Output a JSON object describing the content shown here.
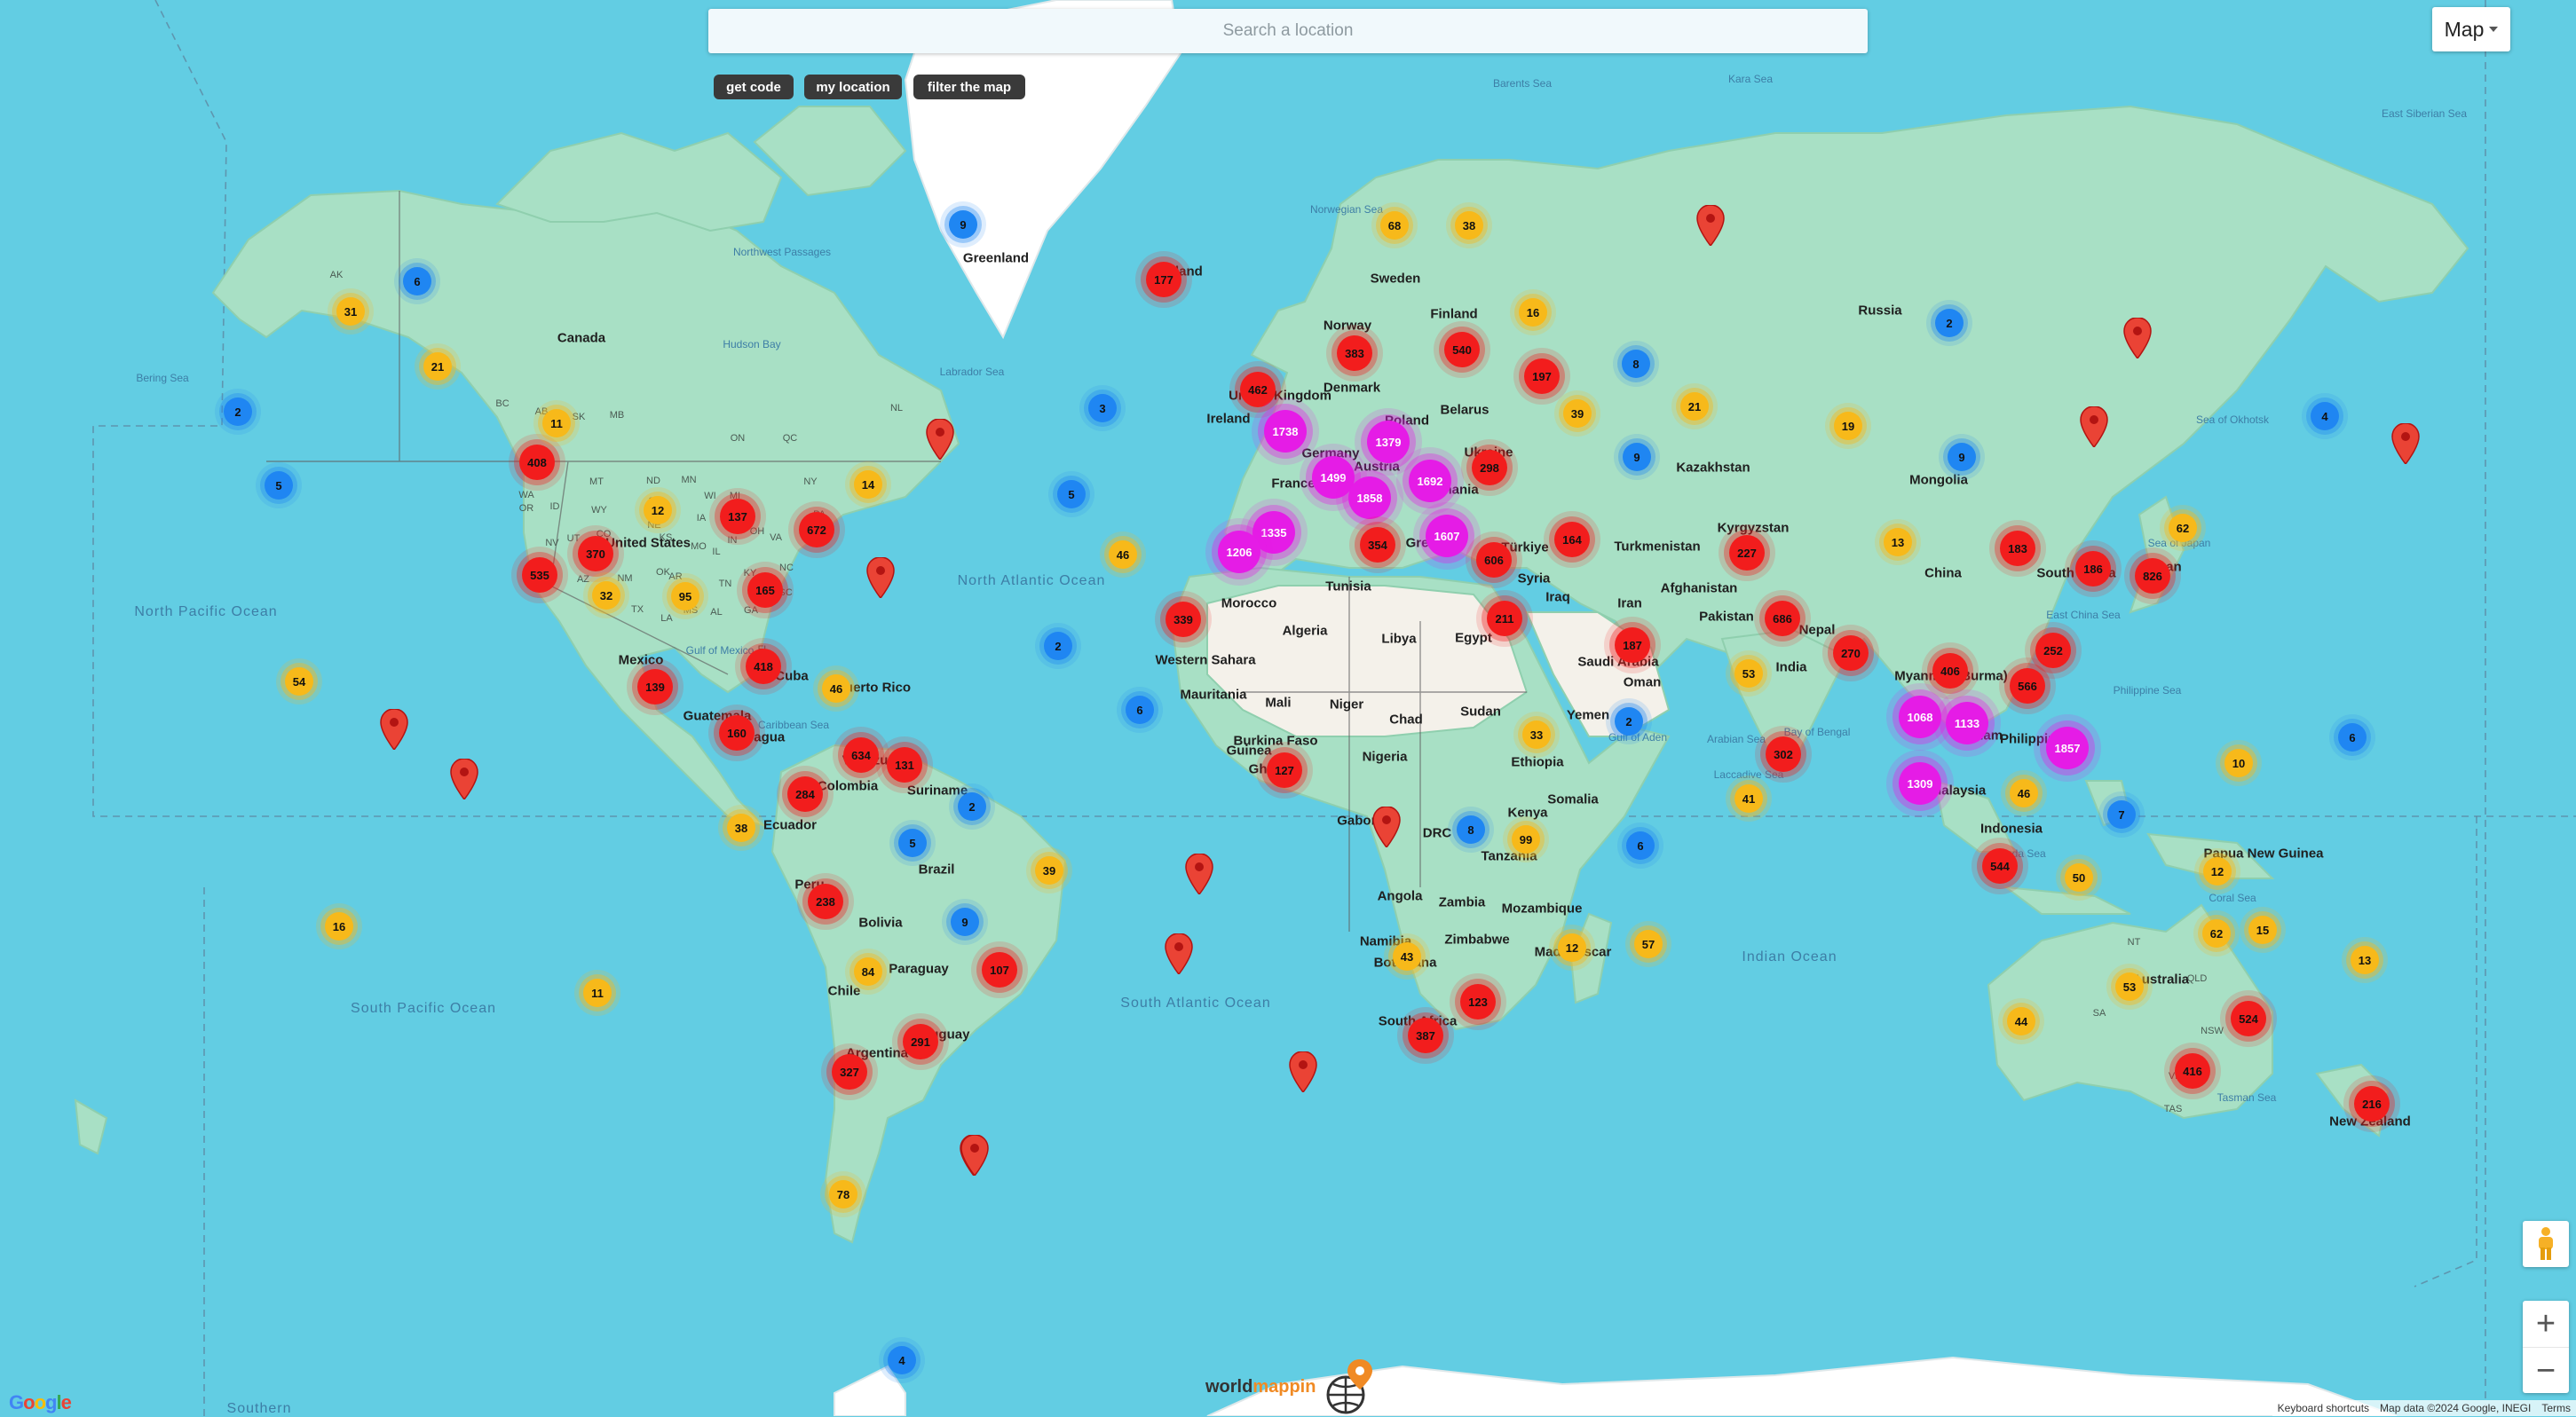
{
  "search": {
    "placeholder": "Search a location"
  },
  "buttons": {
    "get_code": "get code",
    "my_location": "my location",
    "filter_map": "filter the map"
  },
  "map_type": {
    "label": "Map",
    "icon": "caret-down-icon"
  },
  "controls": {
    "pegman_icon": "pegman-icon",
    "zoom_in": "+",
    "zoom_out": "−"
  },
  "attribution": {
    "shortcuts": "Keyboard shortcuts",
    "data": "Map data ©2024 Google, INEGI",
    "terms": "Terms"
  },
  "google_logo": "Google",
  "brand": {
    "name_prefix": "world",
    "name_highlight": "mappin",
    "name_suffix": "pin",
    "icon": "globe-pin-icon"
  },
  "colors": {
    "ocean": "#62cde3",
    "land": "#a8e0c5",
    "cluster_blue": "#1f86f2",
    "cluster_yellow": "#f7b91a",
    "cluster_red": "#f21d1d",
    "cluster_magenta": "#e51ce6",
    "brand_accent": "#f08a24"
  },
  "labels": {
    "countries": [
      "Canada",
      "United States",
      "Mexico",
      "Cuba",
      "Guatemala",
      "Nicaragua",
      "Ecuador",
      "Peru",
      "Bolivia",
      "Brazil",
      "Chile",
      "Argentina",
      "Paraguay",
      "Uruguay",
      "Suriname",
      "Colombia",
      "Venezuela",
      "Puerto Rico",
      "Greenland",
      "Iceland",
      "Norway",
      "Sweden",
      "Finland",
      "Denmark",
      "United Kingdom",
      "Ireland",
      "France",
      "Germany",
      "Poland",
      "Austria",
      "Ukraine",
      "Belarus",
      "Romania",
      "Greece",
      "Türkiye",
      "Syria",
      "Iraq",
      "Iran",
      "Egypt",
      "Libya",
      "Algeria",
      "Tunisia",
      "Morocco",
      "Western Sahara",
      "Mauritania",
      "Mali",
      "Niger",
      "Chad",
      "Sudan",
      "Nigeria",
      "Burkina Faso",
      "Guinea",
      "Ghana",
      "Gabon",
      "DRC",
      "Kenya",
      "Tanzania",
      "Ethiopia",
      "Somalia",
      "Angola",
      "Zambia",
      "Zimbabwe",
      "Mozambique",
      "Namibia",
      "Botswana",
      "South Africa",
      "Madagascar",
      "Saudi Arabia",
      "Yemen",
      "Oman",
      "Kazakhstan",
      "Turkmenistan",
      "Kyrgyzstan",
      "Afghanistan",
      "Pakistan",
      "Nepal",
      "India",
      "Myanmar (Burma)",
      "China",
      "Mongolia",
      "Russia",
      "Japan",
      "South Korea",
      "Vietnam",
      "Philippines",
      "Malaysia",
      "Indonesia",
      "Papua New Guinea",
      "Australia",
      "New Zealand"
    ],
    "oceans": [
      "North Pacific Ocean",
      "North Atlantic Ocean",
      "South Pacific Ocean",
      "South Atlantic Ocean",
      "Indian Ocean",
      "Southern"
    ],
    "seas": [
      "Bering Sea",
      "Labrador Sea",
      "Hudson Bay",
      "Norwegian Sea",
      "Barents Sea",
      "Kara Sea",
      "East Siberian Sea",
      "Sea of Okhotsk",
      "Sea of Japan",
      "East China Sea",
      "Philippine Sea",
      "Caribbean Sea",
      "Gulf of Mexico",
      "Arabian Sea",
      "Bay of Bengal",
      "Gulf of Aden",
      "Banda Sea",
      "Coral Sea",
      "Tasman Sea",
      "Laccadive Sea",
      "Northwest Passages"
    ],
    "regions": [
      "AK",
      "BC",
      "AB",
      "SK",
      "MB",
      "ON",
      "QC",
      "NL",
      "WA",
      "OR",
      "ID",
      "MT",
      "WY",
      "ND",
      "SD",
      "NE",
      "NV",
      "CA",
      "UT",
      "CO",
      "AZ",
      "NM",
      "TX",
      "OK",
      "KS",
      "MN",
      "WI",
      "IA",
      "MO",
      "IL",
      "IN",
      "OH",
      "MI",
      "KY",
      "TN",
      "AL",
      "MS",
      "AR",
      "LA",
      "GA",
      "FL",
      "SC",
      "NC",
      "VA",
      "PA",
      "NY",
      "NT",
      "QLD",
      "NSW",
      "VIC",
      "SA",
      "TAS"
    ]
  },
  "clusters": [
    {
      "count": "9",
      "color": "blue"
    },
    {
      "count": "177",
      "color": "red"
    },
    {
      "count": "68",
      "color": "yellow"
    },
    {
      "count": "38",
      "color": "yellow"
    },
    {
      "count": "6",
      "color": "blue"
    },
    {
      "count": "31",
      "color": "yellow"
    },
    {
      "count": "21",
      "color": "yellow"
    },
    {
      "count": "2",
      "color": "blue"
    },
    {
      "count": "5",
      "color": "blue"
    },
    {
      "count": "408",
      "color": "red"
    },
    {
      "count": "11",
      "color": "yellow"
    },
    {
      "count": "12",
      "color": "yellow"
    },
    {
      "count": "137",
      "color": "red"
    },
    {
      "count": "672",
      "color": "red"
    },
    {
      "count": "14",
      "color": "yellow"
    },
    {
      "count": "370",
      "color": "red"
    },
    {
      "count": "535",
      "color": "red"
    },
    {
      "count": "32",
      "color": "yellow"
    },
    {
      "count": "95",
      "color": "yellow"
    },
    {
      "count": "165",
      "color": "red"
    },
    {
      "count": "54",
      "color": "yellow"
    },
    {
      "count": "139",
      "color": "red"
    },
    {
      "count": "418",
      "color": "red"
    },
    {
      "count": "46",
      "color": "yellow"
    },
    {
      "count": "160",
      "color": "red"
    },
    {
      "count": "634",
      "color": "red"
    },
    {
      "count": "131",
      "color": "red"
    },
    {
      "count": "284",
      "color": "red"
    },
    {
      "count": "2",
      "color": "blue"
    },
    {
      "count": "38",
      "color": "yellow"
    },
    {
      "count": "5",
      "color": "blue"
    },
    {
      "count": "39",
      "color": "yellow"
    },
    {
      "count": "16",
      "color": "yellow"
    },
    {
      "count": "238",
      "color": "red"
    },
    {
      "count": "9",
      "color": "blue"
    },
    {
      "count": "84",
      "color": "yellow"
    },
    {
      "count": "107",
      "color": "red"
    },
    {
      "count": "11",
      "color": "yellow"
    },
    {
      "count": "291",
      "color": "red"
    },
    {
      "count": "327",
      "color": "red"
    },
    {
      "count": "78",
      "color": "yellow"
    },
    {
      "count": "3",
      "color": "blue"
    },
    {
      "count": "5",
      "color": "blue"
    },
    {
      "count": "46",
      "color": "yellow"
    },
    {
      "count": "2",
      "color": "blue"
    },
    {
      "count": "6",
      "color": "blue"
    },
    {
      "count": "4",
      "color": "blue"
    },
    {
      "count": "462",
      "color": "red"
    },
    {
      "count": "1738",
      "color": "magenta"
    },
    {
      "count": "383",
      "color": "red"
    },
    {
      "count": "540",
      "color": "red"
    },
    {
      "count": "16",
      "color": "yellow"
    },
    {
      "count": "197",
      "color": "red"
    },
    {
      "count": "8",
      "color": "blue"
    },
    {
      "count": "1379",
      "color": "magenta"
    },
    {
      "count": "1499",
      "color": "magenta"
    },
    {
      "count": "1692",
      "color": "magenta"
    },
    {
      "count": "298",
      "color": "red"
    },
    {
      "count": "1858",
      "color": "magenta"
    },
    {
      "count": "1335",
      "color": "magenta"
    },
    {
      "count": "1206",
      "color": "magenta"
    },
    {
      "count": "354",
      "color": "red"
    },
    {
      "count": "1607",
      "color": "magenta"
    },
    {
      "count": "606",
      "color": "red"
    },
    {
      "count": "39",
      "color": "yellow"
    },
    {
      "count": "21",
      "color": "yellow"
    },
    {
      "count": "164",
      "color": "red"
    },
    {
      "count": "339",
      "color": "red"
    },
    {
      "count": "211",
      "color": "red"
    },
    {
      "count": "187",
      "color": "red"
    },
    {
      "count": "33",
      "color": "yellow"
    },
    {
      "count": "2",
      "color": "blue"
    },
    {
      "count": "127",
      "color": "red"
    },
    {
      "count": "8",
      "color": "blue"
    },
    {
      "count": "99",
      "color": "yellow"
    },
    {
      "count": "6",
      "color": "blue"
    },
    {
      "count": "43",
      "color": "yellow"
    },
    {
      "count": "12",
      "color": "yellow"
    },
    {
      "count": "57",
      "color": "yellow"
    },
    {
      "count": "123",
      "color": "red"
    },
    {
      "count": "387",
      "color": "red"
    },
    {
      "count": "2",
      "color": "blue"
    },
    {
      "count": "9",
      "color": "blue"
    },
    {
      "count": "19",
      "color": "yellow"
    },
    {
      "count": "9",
      "color": "blue"
    },
    {
      "count": "227",
      "color": "red"
    },
    {
      "count": "13",
      "color": "yellow"
    },
    {
      "count": "686",
      "color": "red"
    },
    {
      "count": "53",
      "color": "yellow"
    },
    {
      "count": "270",
      "color": "red"
    },
    {
      "count": "302",
      "color": "red"
    },
    {
      "count": "41",
      "color": "yellow"
    },
    {
      "count": "183",
      "color": "red"
    },
    {
      "count": "186",
      "color": "red"
    },
    {
      "count": "826",
      "color": "red"
    },
    {
      "count": "62",
      "color": "yellow"
    },
    {
      "count": "4",
      "color": "blue"
    },
    {
      "count": "406",
      "color": "red"
    },
    {
      "count": "252",
      "color": "red"
    },
    {
      "count": "566",
      "color": "red"
    },
    {
      "count": "1068",
      "color": "magenta"
    },
    {
      "count": "1133",
      "color": "magenta"
    },
    {
      "count": "1857",
      "color": "magenta"
    },
    {
      "count": "1309",
      "color": "magenta"
    },
    {
      "count": "46",
      "color": "yellow"
    },
    {
      "count": "544",
      "color": "red"
    },
    {
      "count": "7",
      "color": "blue"
    },
    {
      "count": "50",
      "color": "yellow"
    },
    {
      "count": "12",
      "color": "yellow"
    },
    {
      "count": "10",
      "color": "yellow"
    },
    {
      "count": "6",
      "color": "blue"
    },
    {
      "count": "62",
      "color": "yellow"
    },
    {
      "count": "15",
      "color": "yellow"
    },
    {
      "count": "13",
      "color": "yellow"
    },
    {
      "count": "53",
      "color": "yellow"
    },
    {
      "count": "44",
      "color": "yellow"
    },
    {
      "count": "524",
      "color": "red"
    },
    {
      "count": "416",
      "color": "red"
    },
    {
      "count": "216",
      "color": "red"
    }
  ],
  "pins_count": 14
}
